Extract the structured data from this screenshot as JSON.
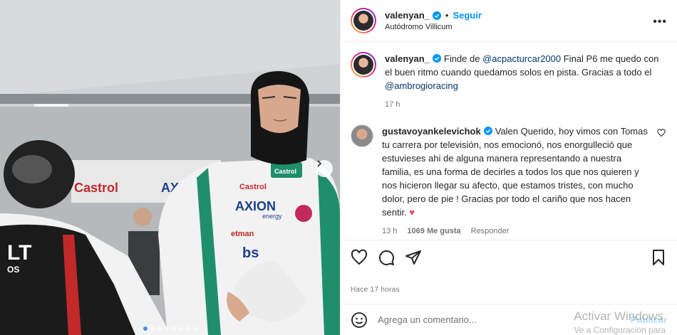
{
  "post": {
    "username": "valenyan_",
    "follow_label": "Seguir",
    "separator": "•",
    "location": "Autódromo Villicum"
  },
  "caption": {
    "username": "valenyan_",
    "text_before": "Finde de ",
    "mention_1": "@acpacturcar2000",
    "text_middle": " Final P6 me quedo con el buen ritmo cuando quedamos solos en pista. Gracias a todo el ",
    "mention_2": "@ambrogioracing",
    "time": "17 h"
  },
  "comment": {
    "username": "gustavoyankelevichok",
    "text": "Valen Querido, hoy vimos con Tomas tu carrera por televisión, nos emocionó, nos enorgulleció que estuvieses ahi de alguna manera representando a nuestra familia, es una forma de decirles a todos los que nos quieren y nos hicieron llegar su afecto, que estamos tristes, con mucho dolor, pero de pie ! Gracias por todo el cariño que nos hacen sentir.",
    "emoji": "♥",
    "time": "13 h",
    "likes": "1069 Me gusta",
    "reply_label": "Responder"
  },
  "footer": {
    "time_ago": "Hace 17 horas",
    "comment_placeholder": "Agrega un comentario...",
    "publish_label": "Publicar"
  },
  "watermark": {
    "line1": "Activar Windows",
    "line2": "Ve a Configuración para"
  },
  "carousel": {
    "dots": 8,
    "active_index": 0
  },
  "icons": [
    "verified-icon",
    "more-options-icon",
    "heart-icon",
    "comment-icon",
    "share-icon",
    "bookmark-icon",
    "emoji-icon",
    "next-arrow-icon"
  ],
  "colors": {
    "accent": "#0095f6",
    "verified": "#0095f6",
    "heart": "#ed4956",
    "mention": "#00376b"
  }
}
